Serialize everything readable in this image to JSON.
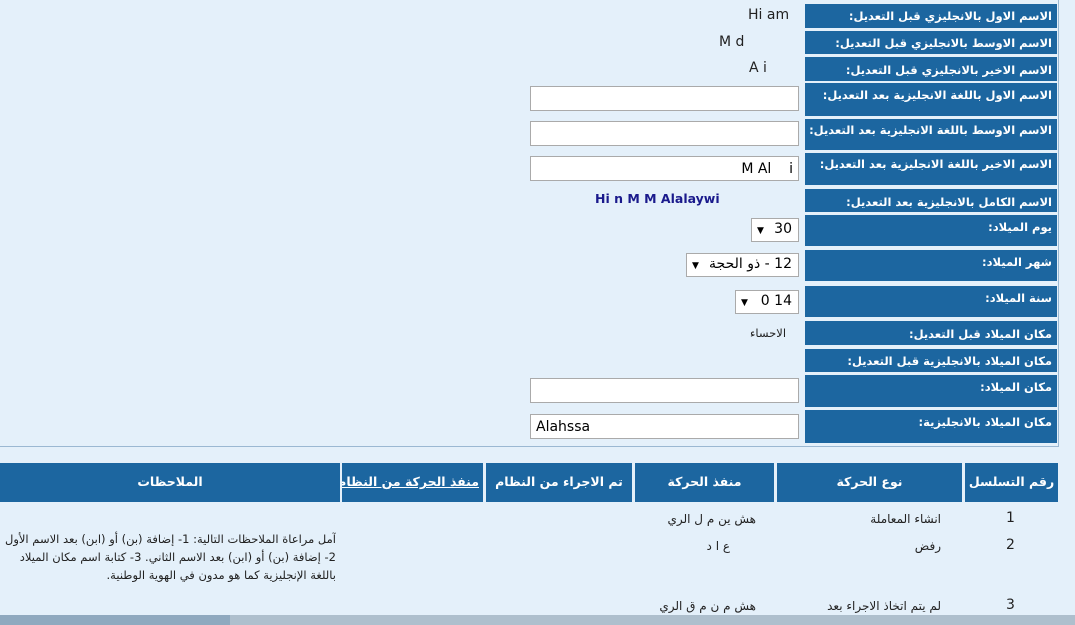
{
  "form": {
    "rows": [
      {
        "label": "الاسم الاول بالانجليزي قبل التعديل:",
        "value": "Hi  am"
      },
      {
        "label": "الاسم الاوسط بالانجليزي قبل التعديل:",
        "value": "M        d"
      },
      {
        "label": "الاسم الاخير بالانجليزي قبل التعديل:",
        "value": "A      i"
      },
      {
        "label": "الاسم الاول باللغة الانجليزية بعد التعديل:",
        "value": ""
      },
      {
        "label": "الاسم الاوسط باللغة الانجليزية بعد التعديل:",
        "value": ""
      },
      {
        "label": "الاسم الاخير باللغة الانجليزية بعد التعديل:",
        "value": "M Al    i"
      },
      {
        "label": "الاسم الكامل بالانجليزية بعد التعديل:",
        "value": "Hi      n M           M Alalaywi"
      },
      {
        "label": "يوم الميلاد:",
        "value": "30"
      },
      {
        "label": "شهر الميلاد:",
        "value": "12 - ذو الحجة"
      },
      {
        "label": "سنة الميلاد:",
        "value": "14 0"
      },
      {
        "label": "مكان الميلاد قبل التعديل:",
        "value": "الاحساء"
      },
      {
        "label": "مكان الميلاد بالانجليزية قبل التعديل:",
        "value": ""
      },
      {
        "label": "مكان الميلاد:",
        "value": ""
      },
      {
        "label": "مكان الميلاد بالانجليزية:",
        "value": "Alahssa"
      }
    ]
  },
  "table": {
    "headers": {
      "seq": "رقم التسلسل",
      "type": "نوع الحركة",
      "executor": "منفذ الحركة",
      "system_done": "تم الاجراء من النظام",
      "system_exec": "منفذ الحركة من النظام",
      "notes": "الملاحظات"
    },
    "rows": [
      {
        "seq": "1",
        "type": "انشاء المعاملة",
        "executor": "هش      ين م        ل  الري"
      },
      {
        "seq": "2",
        "type": "رفض",
        "executor": "ع   ا    د"
      },
      {
        "seq": "3",
        "type": "لم يتم اتخاذ الاجراء بعد",
        "executor": "هش    م     ن م   ق   الري"
      }
    ],
    "notes_text": "آمل مراعاة الملاحظات التالية: 1- إضافة (بن) أو (ابن) بعد الاسم الأول 2- إضافة (بن) أو (ابن) بعد الاسم الثاني. 3- كتابة اسم مكان الميلاد باللغة الإنجليزية كما هو مدون في الهوية الوطنية."
  }
}
